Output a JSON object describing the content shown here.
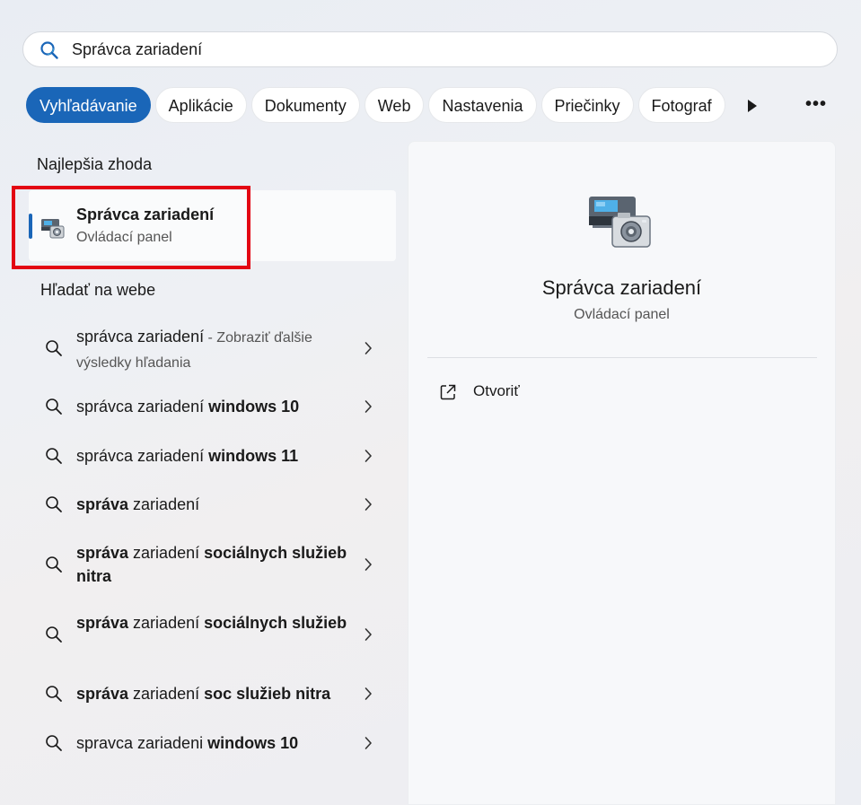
{
  "search": {
    "value": "Správca zariadení"
  },
  "filters": [
    "Vyhľadávanie",
    "Aplikácie",
    "Dokumenty",
    "Web",
    "Nastavenia",
    "Priečinky",
    "Fotograf"
  ],
  "more_label": "•••",
  "best_match": {
    "heading": "Najlepšia zhoda",
    "title": "Správca zariadení",
    "subtitle": "Ovládací panel"
  },
  "web": {
    "heading": "Hľadať na webe",
    "items": [
      {
        "parts": [
          [
            "správca zariadení",
            false
          ]
        ],
        "suffix": " - Zobraziť ďalšie výsledky hľadania"
      },
      {
        "parts": [
          [
            "správca zariadení ",
            false
          ],
          [
            "windows 10",
            true
          ]
        ]
      },
      {
        "parts": [
          [
            "správca zariadení ",
            false
          ],
          [
            "windows 11",
            true
          ]
        ]
      },
      {
        "parts": [
          [
            "správa",
            true
          ],
          [
            " zariadení",
            false
          ]
        ]
      },
      {
        "parts": [
          [
            "správa",
            true
          ],
          [
            " zariadení ",
            false
          ],
          [
            "sociálnych služieb nitra",
            true
          ]
        ]
      },
      {
        "parts": [
          [
            "správa",
            true
          ],
          [
            " zariadení ",
            false
          ],
          [
            "sociálnych služieb",
            true
          ]
        ]
      },
      {
        "parts": [
          [
            "správa",
            true
          ],
          [
            " zariadení ",
            false
          ],
          [
            "soc služieb nitra",
            true
          ]
        ]
      },
      {
        "parts": [
          [
            "spravca zariadeni ",
            false
          ],
          [
            "windows 10",
            true
          ]
        ]
      }
    ]
  },
  "detail": {
    "title": "Správca zariadení",
    "subtitle": "Ovládací panel",
    "action": "Otvoriť"
  },
  "colors": {
    "accent": "#1a66b8",
    "highlight": "#e30613"
  }
}
